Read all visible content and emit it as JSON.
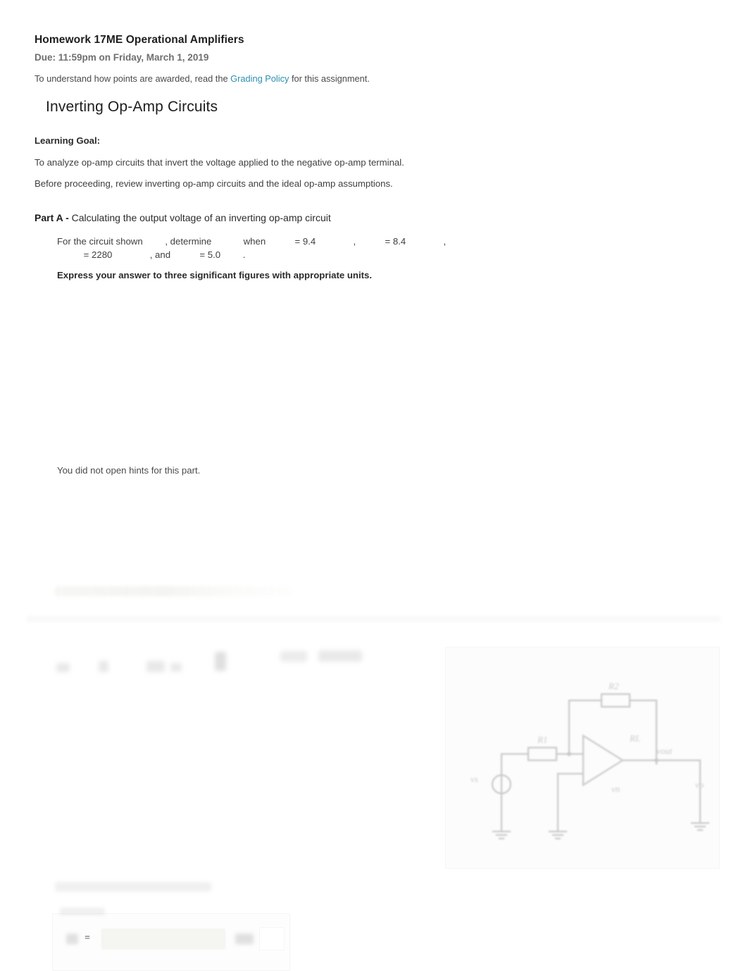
{
  "header": {
    "title": "Homework 17ME Operational Amplifiers",
    "due": "Due: 11:59pm on Friday, March 1, 2019",
    "grading_prefix": "To understand how points are awarded, read the ",
    "grading_link": "Grading Policy",
    "grading_suffix": " for this assignment."
  },
  "section": {
    "title": "Inverting Op-Amp Circuits"
  },
  "learning_goal": {
    "label": "Learning Goal:",
    "line1": "To analyze op-amp circuits that invert the voltage applied to the negative op-amp terminal.",
    "line2": "Before proceeding, review inverting op-amp circuits and the ideal op-amp assumptions."
  },
  "part_a": {
    "label": "Part A -",
    "title": "Calculating the output voltage of an inverting op-amp circuit",
    "prompt": {
      "t1": "For the circuit shown ",
      "t2": ", determine ",
      "t3": " when ",
      "t4": " = 9.4 ",
      "t5": " , ",
      "t6": " = 8.4 ",
      "t7": " , ",
      "t8": " = 2280 ",
      "t9": " , and ",
      "t10": " = 5.0 ",
      "t11": "."
    },
    "express": "Express your answer to three significant figures with appropriate units.",
    "hints_note": "You did not open hints for this part.",
    "equals_sign": "="
  },
  "colors": {
    "link": "#2d8fae",
    "title_text": "#1d1d1d",
    "body_text": "#3f3f3f",
    "due_text": "#6f6f6f",
    "page_background": "#ffffff"
  }
}
